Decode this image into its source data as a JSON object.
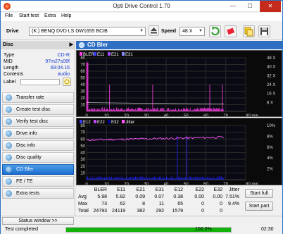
{
  "window": {
    "title": "Opti Drive Control 1.70",
    "minimize": "—",
    "maximize": "☐",
    "close": "✕"
  },
  "menu": [
    "File",
    "Start test",
    "Extra",
    "Help"
  ],
  "drive": {
    "label": "Drive",
    "value": "(K:)  BENQ DVD LS DW1655 BCIB",
    "speed_label": "Speed",
    "speed_value": "48 X"
  },
  "disc": {
    "header": "Disc",
    "rows": [
      {
        "key": "Type",
        "value": "CD-R"
      },
      {
        "key": "MID",
        "value": "97m27s08f"
      },
      {
        "key": "Length",
        "value": "69:04.16"
      },
      {
        "key": "Contents",
        "value": "audio"
      }
    ],
    "label_key": "Label"
  },
  "nav": [
    "Transfer rate",
    "Create test disc",
    "Verify test disc",
    "Drive info",
    "Disc info",
    "Disc quality",
    "CD Bler",
    "FE / TE",
    "Extra tests"
  ],
  "active_nav_index": 6,
  "main_title": "CD Bler",
  "colors": {
    "bler": "#ff3ce6",
    "e11": "#3c3cff",
    "e21": "#a24bff",
    "e31": "#8c8cff",
    "e12": "#3c3cff",
    "e22": "#c040ff",
    "e32": "#0000a0",
    "jitter": "#ff55ff",
    "fill_bars": "#2020ff",
    "green_status": "#13b20b"
  },
  "chart_data": [
    {
      "type": "bar",
      "legend": [
        "BLER",
        "E11",
        "E21",
        "E31"
      ],
      "x_ticks": [
        "0",
        "10",
        "20",
        "30",
        "40",
        "50",
        "60",
        "70",
        "80 min"
      ],
      "xlim": [
        0,
        80
      ],
      "y_ticks_left": [
        "80",
        "70",
        "60",
        "50",
        "40",
        "30",
        "20",
        "10"
      ],
      "y_ticks_right": [
        "48 X",
        "40 X",
        "32 X",
        "24 X",
        "16 X",
        "8 X"
      ],
      "ylim": [
        0,
        80
      ],
      "grid": true
    },
    {
      "type": "area",
      "legend": [
        "E12",
        "E22",
        "E32",
        "Jitter"
      ],
      "x_ticks": [
        "0",
        "10",
        "20",
        "30",
        "40",
        "50",
        "60",
        "70",
        "80 min"
      ],
      "xlim": [
        0,
        80
      ],
      "y_ticks_left": [
        "80",
        "70",
        "60",
        "50",
        "40",
        "30",
        "20",
        "10"
      ],
      "y_ticks_right": [
        "10%",
        "8%",
        "6%",
        "4%",
        "2%"
      ],
      "ylim": [
        0,
        80
      ],
      "grid": true
    }
  ],
  "stats": {
    "cols": [
      "BLER",
      "E11",
      "E21",
      "E31",
      "E12",
      "E22",
      "E32",
      "Jitter"
    ],
    "rows": [
      {
        "label": "Avg",
        "values": [
          "5.98",
          "5.82",
          "0.09",
          "0.07",
          "0.38",
          "0.00",
          "0.00",
          "7.51%"
        ]
      },
      {
        "label": "Max",
        "values": [
          "73",
          "62",
          "8",
          "11",
          "65",
          "0",
          "0",
          "9.4%"
        ]
      },
      {
        "label": "Total",
        "values": [
          "24793",
          "24119",
          "382",
          "292",
          "1579",
          "0",
          "0",
          ""
        ]
      }
    ],
    "start_full": "Start full",
    "start_part": "Start part"
  },
  "status": {
    "window_btn": "Status window >>",
    "message": "Test completed",
    "progress_text": "100.0%",
    "time": "02:30",
    "progress": 1.0
  }
}
